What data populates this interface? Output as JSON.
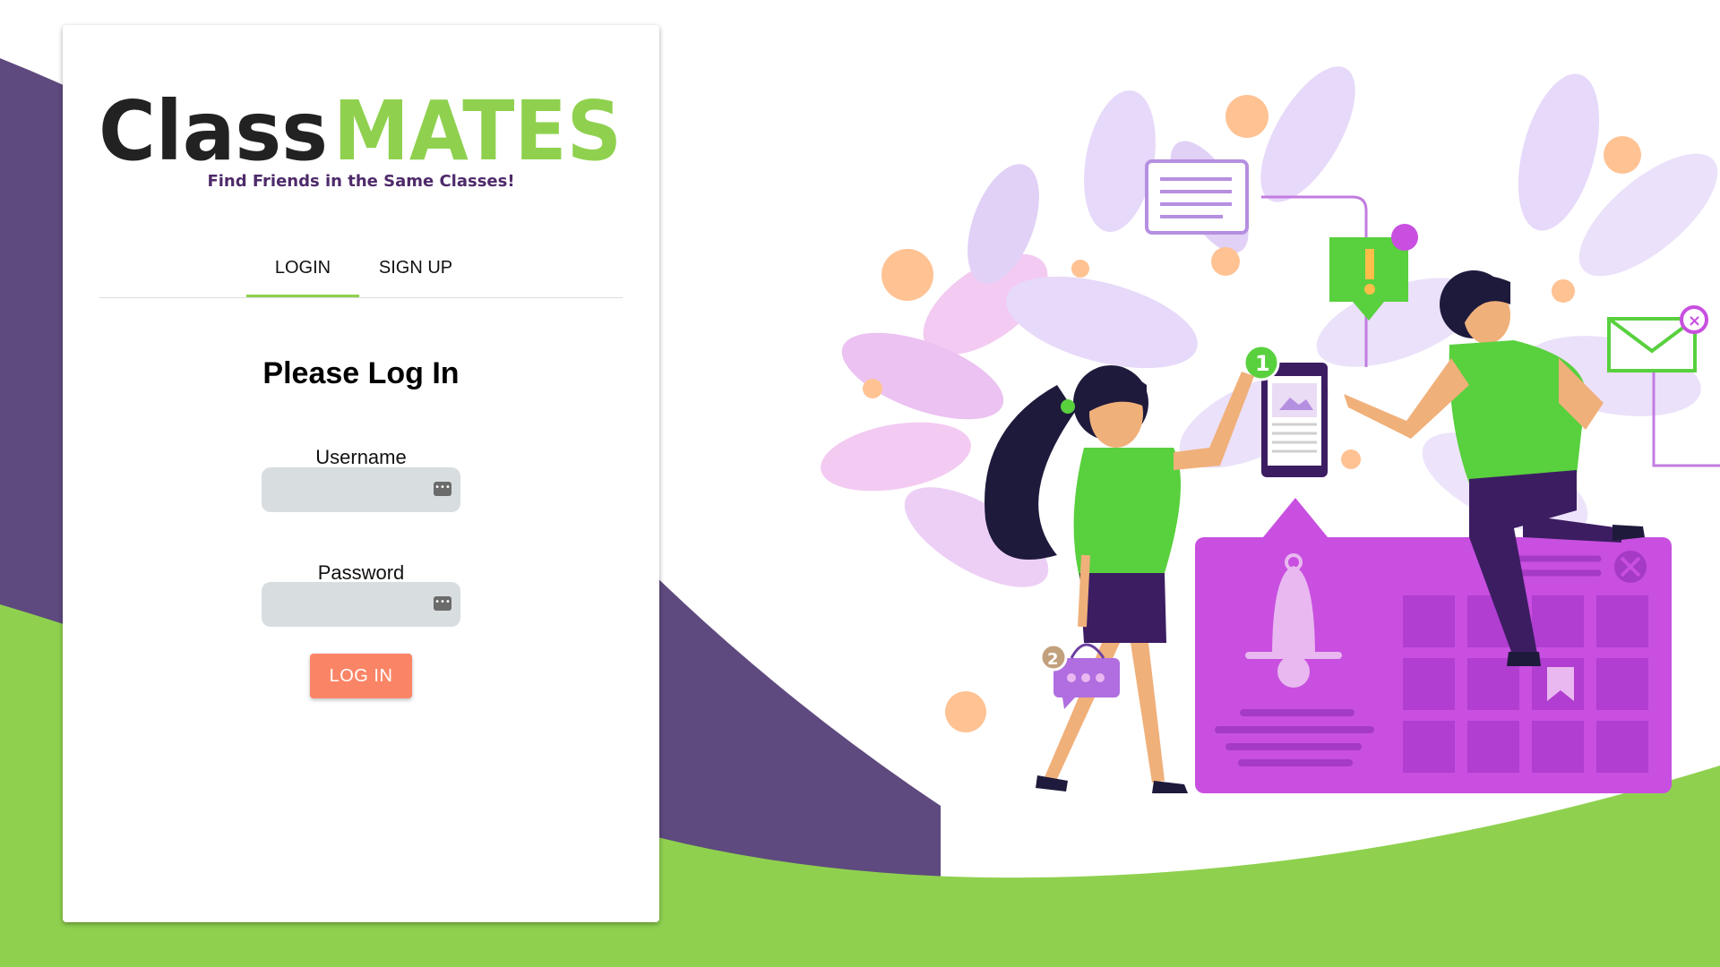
{
  "brand": {
    "name_part1": "Class",
    "name_part2": "MATES",
    "tagline": "Find Friends in the Same Classes!",
    "dark_color": "#222222",
    "accent_color": "#8fd14f",
    "purple_color": "#5e4a7e"
  },
  "tabs": [
    {
      "label": "LOGIN",
      "active": true
    },
    {
      "label": "SIGN UP",
      "active": false
    }
  ],
  "form": {
    "title": "Please Log In",
    "username_label": "Username",
    "username_value": "",
    "password_label": "Password",
    "password_value": "",
    "submit_label": "LOG IN",
    "submit_color": "#fa8566",
    "field_icon": "password-manager-key-icon"
  },
  "illustration": {
    "badge_1": "1",
    "badge_2": "2"
  }
}
